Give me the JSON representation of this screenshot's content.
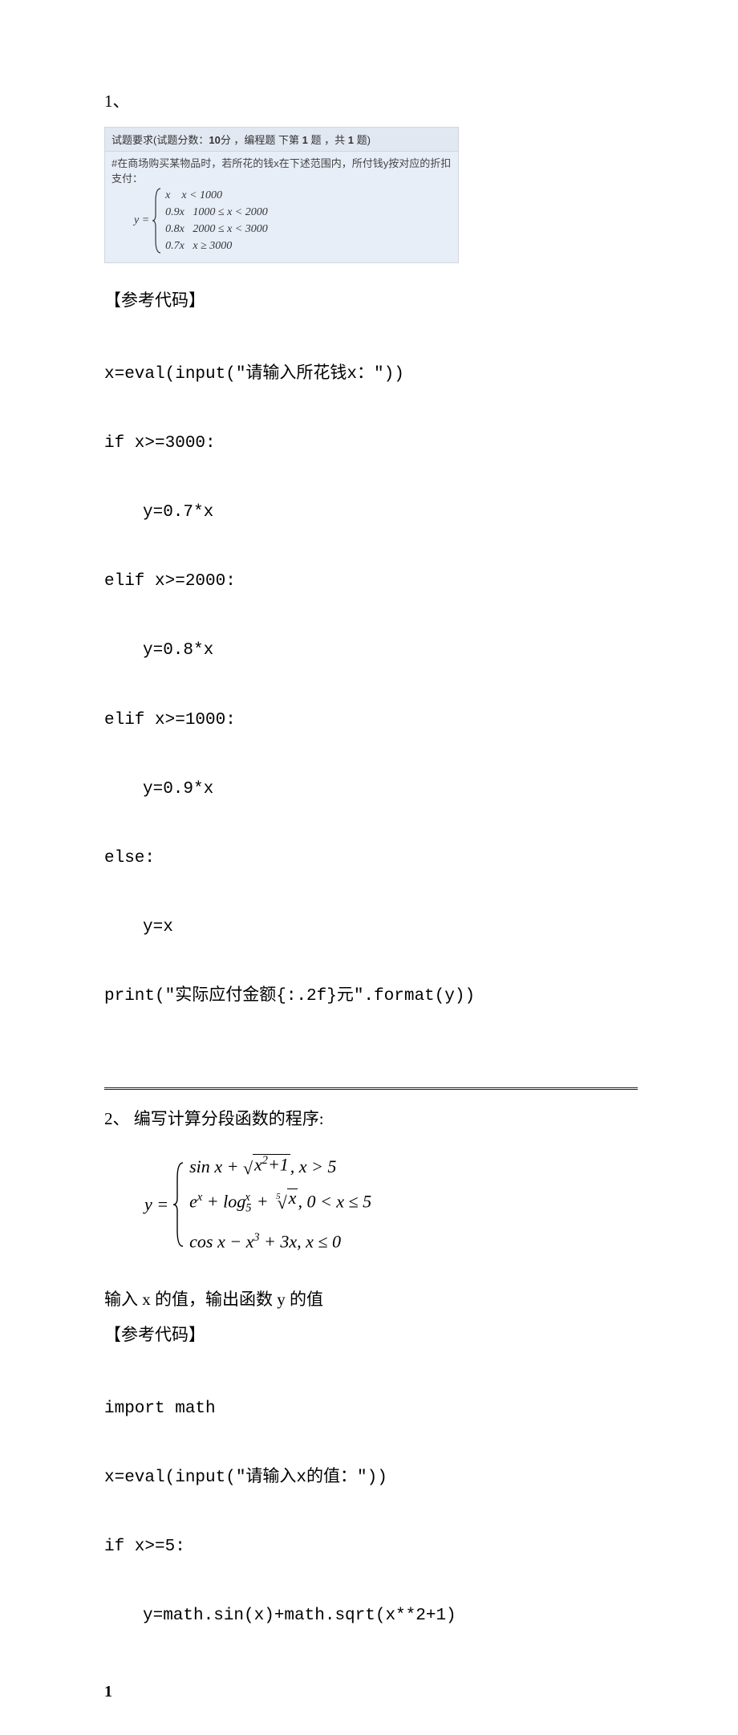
{
  "q1": {
    "number": "1、",
    "header": {
      "prefix": "试题要求(试题分数：",
      "score": "10",
      "mid1": "分 ，编程题 下第 ",
      "qn": "1",
      "mid2": " 题 ，共 ",
      "total": "1",
      "suffix": " 题)"
    },
    "desc": "#在商场购买某物品时，若所花的钱x在下述范围内，所付钱y按对应的折扣支付：",
    "lhs": "y =",
    "cases": {
      "c1": "x    x < 1000",
      "c2": "0.9x   1000 ≤ x < 2000",
      "c3": "0.8x   2000 ≤ x < 3000",
      "c4": "0.7x   x ≥ 3000"
    },
    "ref_label": "【参考代码】",
    "code": {
      "l1": "x=eval(input(\"请输入所花钱x：\"))",
      "l2": "if x>=3000:",
      "l3": "y=0.7*x",
      "l4": "elif x>=2000:",
      "l5": "y=0.8*x",
      "l6": "elif x>=1000:",
      "l7": "y=0.9*x",
      "l8": "else:",
      "l9": "y=x",
      "l10": "print(\"实际应付金额{:.2f}元\".format(y))"
    }
  },
  "q2": {
    "title": "2、 编写计算分段函数的程序:",
    "lhs": "y =",
    "hint": "输入 x 的值，输出函数 y 的值",
    "ref_label": "【参考代码】",
    "code": {
      "l1": "import math",
      "l2": "x=eval(input(\"请输入x的值：\"))",
      "l3": "if x>=5:",
      "l4": "y=math.sin(x)+math.sqrt(x**2+1)"
    },
    "cases": {
      "c1_cond": ",    x > 5",
      "c2_cond": ",    0 < x ≤ 5",
      "c3_cond": ",    x ≤ 0"
    }
  },
  "page_number": "1"
}
